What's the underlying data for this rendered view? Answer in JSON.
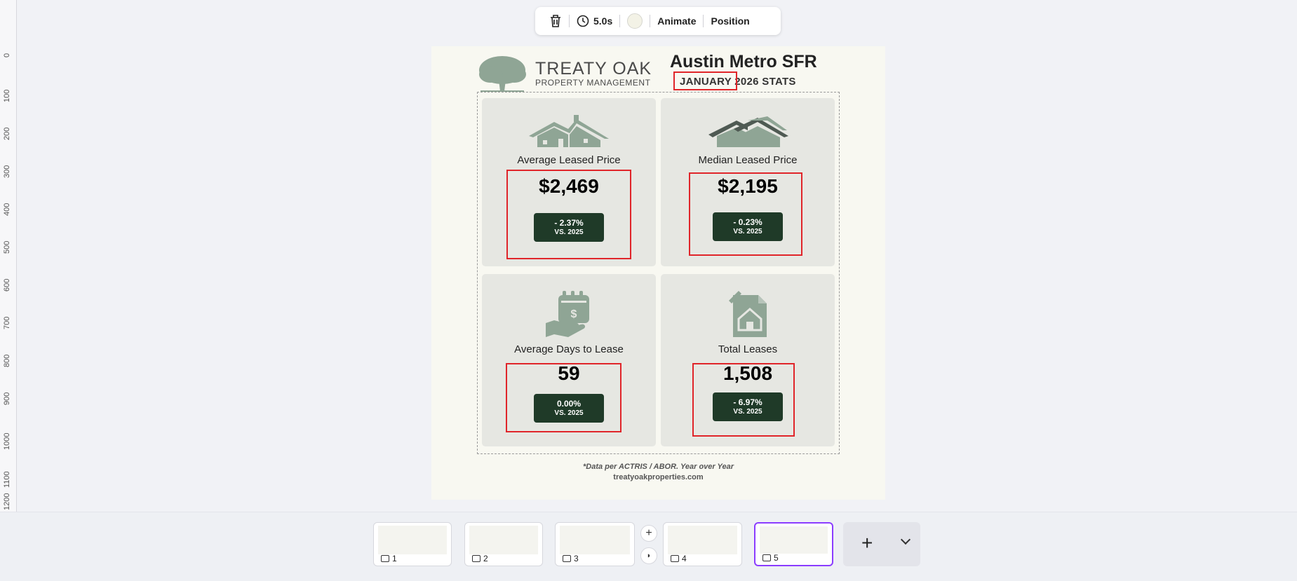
{
  "ruler": {
    "ticks": [
      "0",
      "100",
      "200",
      "300",
      "400",
      "500",
      "600",
      "700",
      "800",
      "900",
      "1000",
      "1100",
      "1200"
    ]
  },
  "toolbar": {
    "delete_icon": "trash-icon",
    "duration": "5.0s",
    "color": "#f3f2e6",
    "animate_label": "Animate",
    "position_label": "Position"
  },
  "page": {
    "logo": {
      "name": "TREATY OAK",
      "tagline": "PROPERTY MANAGEMENT"
    },
    "title": "Austin Metro SFR",
    "subtitle": "JANUARY 2026 STATS",
    "cards": [
      {
        "label": "Average Leased Price",
        "value": "$2,469",
        "pct": "- 2.37%",
        "vs": "VS. 2025",
        "icon": "house-icon"
      },
      {
        "label": "Median Leased Price",
        "value": "$2,195",
        "pct": "- 0.23%",
        "vs": "VS. 2025",
        "icon": "houses-icon"
      },
      {
        "label": "Average Days to Lease",
        "value": "59",
        "pct": "0.00%",
        "vs": "VS. 2025",
        "icon": "calendar-money-icon"
      },
      {
        "label": "Total Leases",
        "value": "1,508",
        "pct": "- 6.97%",
        "vs": "VS. 2025",
        "icon": "document-house-icon"
      }
    ],
    "footer_note": "*Data per ACTRIS / ABOR. Year over Year",
    "footer_url": "treatyoakproperties.com",
    "colors": {
      "badge": "#1f3a28",
      "accent_green": "#8fa595",
      "highlight_red": "#e0252a"
    }
  },
  "thumbnails": [
    {
      "num": "1"
    },
    {
      "num": "2"
    },
    {
      "num": "3"
    },
    {
      "num": "4"
    },
    {
      "num": "5",
      "active": true
    }
  ]
}
